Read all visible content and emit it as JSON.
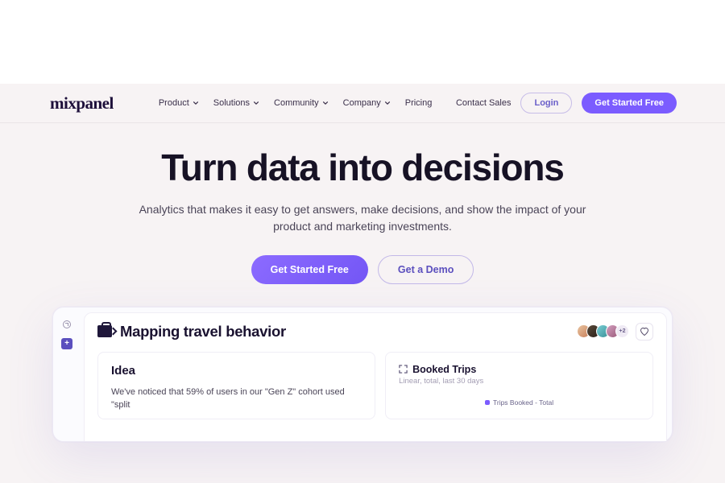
{
  "logo": "mixpanel",
  "nav": {
    "items": [
      {
        "label": "Product"
      },
      {
        "label": "Solutions"
      },
      {
        "label": "Community"
      },
      {
        "label": "Company"
      },
      {
        "label": "Pricing"
      }
    ],
    "contact": "Contact Sales",
    "login": "Login",
    "cta": "Get Started Free"
  },
  "hero": {
    "title": "Turn data into decisions",
    "subtitle": "Analytics that makes it easy to get answers, make decisions, and show the impact of your product and marketing investments.",
    "cta_primary": "Get Started Free",
    "cta_secondary": "Get a Demo"
  },
  "dashboard": {
    "title": "Mapping travel behavior",
    "avatar_more": "+2",
    "idea": {
      "heading": "Idea",
      "body": "We've noticed that 59% of users in our \"Gen Z\" cohort used \"split"
    },
    "booked": {
      "title": "Booked Trips",
      "subtitle": "Linear, total, last 30 days",
      "legend": "Trips Booked - Total"
    }
  }
}
